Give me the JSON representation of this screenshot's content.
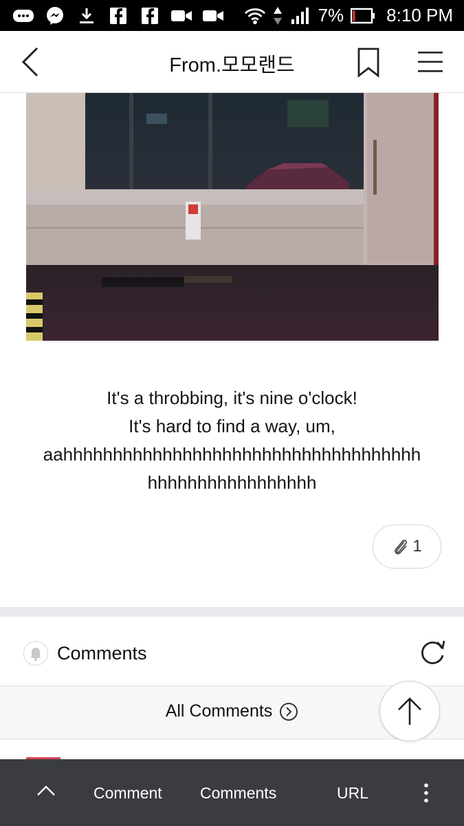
{
  "status_bar": {
    "battery_percent": "7%",
    "time": "8:10 PM",
    "icons": [
      "messages-icon",
      "messenger-icon",
      "download-icon",
      "facebook-icon",
      "facebook-icon",
      "video-camera-icon",
      "video-camera-icon",
      "wifi-icon",
      "data-arrows-icon",
      "signal-icon",
      "battery-icon"
    ]
  },
  "header": {
    "title": "From.모모랜드",
    "icons": [
      "back-icon",
      "bookmark-icon",
      "menu-icon"
    ]
  },
  "post": {
    "lines": [
      "It's a throbbing, it's nine o'clock!",
      "It's hard to find a way, um,",
      "aahhhhhhhhhhhhhhhhhhhhhhhhhhhhhhhhhhhh",
      "hhhhhhhhhhhhhhhhh"
    ],
    "attachment_count": "1"
  },
  "comments": {
    "label": "Comments",
    "all_label": "All Comments"
  },
  "bottom_bar": {
    "comment_label": "Comment",
    "comments_label": "Comments",
    "url_label": "URL"
  },
  "colors": {
    "status_bar": "#000000",
    "bottom_bar": "#3b3c40",
    "divider": "#e9eaee"
  }
}
